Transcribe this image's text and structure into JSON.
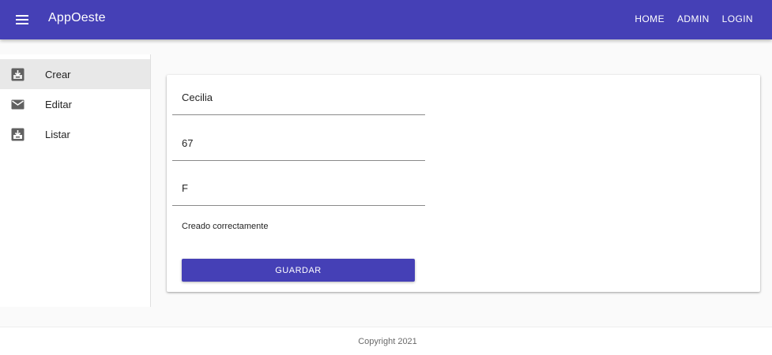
{
  "app_bar": {
    "title": "AppOeste",
    "menu_icon": "hamburger-menu-icon",
    "nav": [
      {
        "label": "HOME"
      },
      {
        "label": "ADMIN"
      },
      {
        "label": "LOGIN"
      }
    ],
    "color": "#4540b6"
  },
  "sidebar": {
    "items": [
      {
        "label": "Crear",
        "icon": "move-to-inbox-icon",
        "active": true
      },
      {
        "label": "Editar",
        "icon": "mail-icon",
        "active": false
      },
      {
        "label": "Listar",
        "icon": "move-to-inbox-icon",
        "active": false
      }
    ]
  },
  "form": {
    "fields": [
      {
        "value": "Cecilia"
      },
      {
        "value": "67"
      },
      {
        "value": "F"
      }
    ],
    "status_message": "Creado correctamente",
    "save_label": "GUARDAR"
  },
  "footer": {
    "copyright": "Copyright 2021"
  }
}
